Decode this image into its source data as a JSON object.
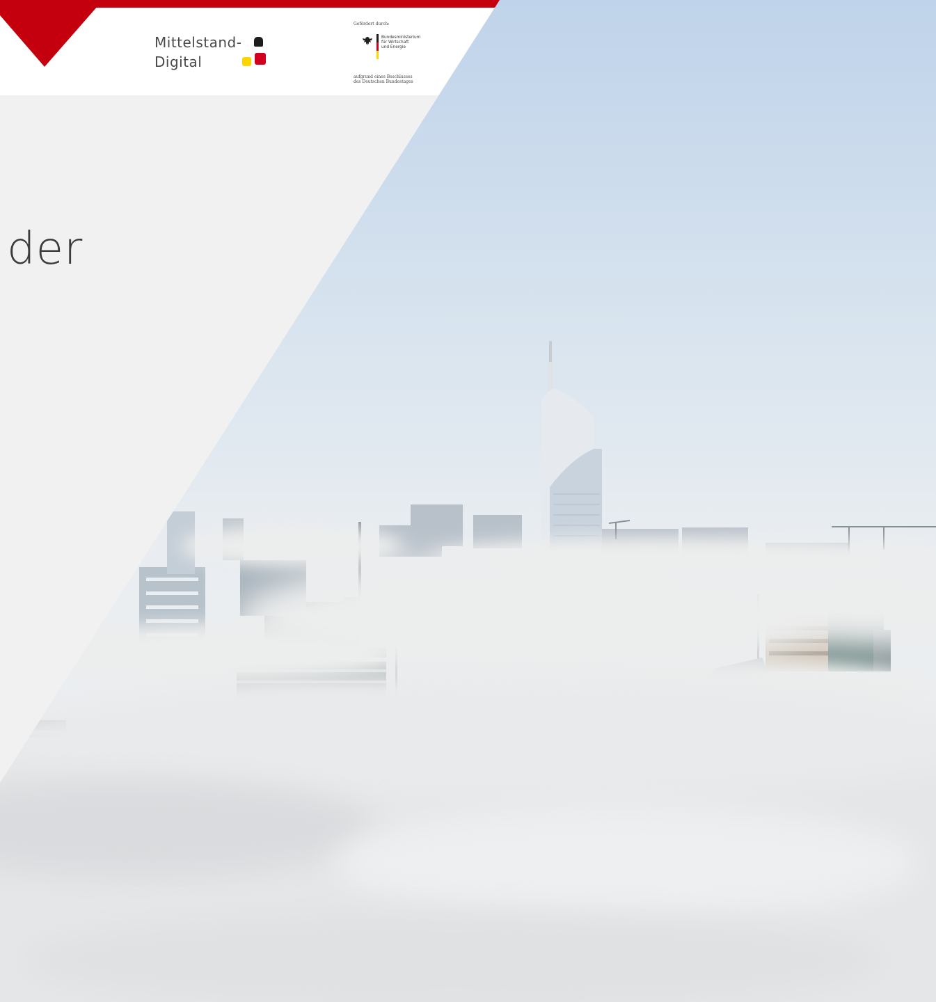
{
  "hero": {
    "headline_fragment": "der"
  },
  "logos": {
    "mittelstand": {
      "line1": "Mittelstand-",
      "line2": "Digital",
      "colors": [
        "#1d1d1b",
        "#ffd500",
        "#d2001e"
      ]
    },
    "bmwi": {
      "funded_by": "Gefördert durch:",
      "ministry_lines": [
        "Bundesministerium",
        "für Wirtschaft",
        "und Energie"
      ],
      "decision_lines": [
        "aufgrund eines Beschlusses",
        "des Deutschen Bundestages"
      ],
      "emblem_icon": "federal-eagle-icon"
    }
  },
  "colors": {
    "brand_red": "#c4000f",
    "panel_grey": "#f1f1f1",
    "header_white": "#ffffff",
    "sky": "#cfdceb",
    "fog": "#e6e6e8"
  }
}
